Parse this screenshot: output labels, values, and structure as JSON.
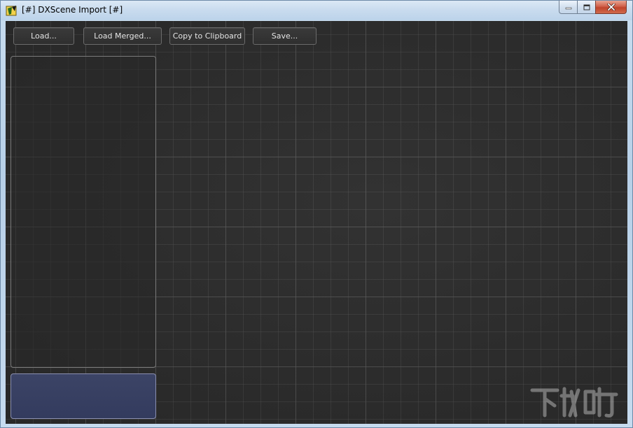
{
  "window": {
    "title": "[#] DXScene Import [#]"
  },
  "toolbar": {
    "load_label": "Load...",
    "load_merged_label": "Load Merged...",
    "copy_label": "Copy to Clipboard",
    "save_label": "Save..."
  },
  "colors": {
    "viewport_bg": "#2e2e2e",
    "info_panel_bg": "#363e62",
    "close_button": "#c94a35"
  },
  "icons": {
    "app": "app-logo-icon",
    "minimize": "minimize-icon",
    "maximize": "maximize-icon",
    "close": "close-icon"
  }
}
